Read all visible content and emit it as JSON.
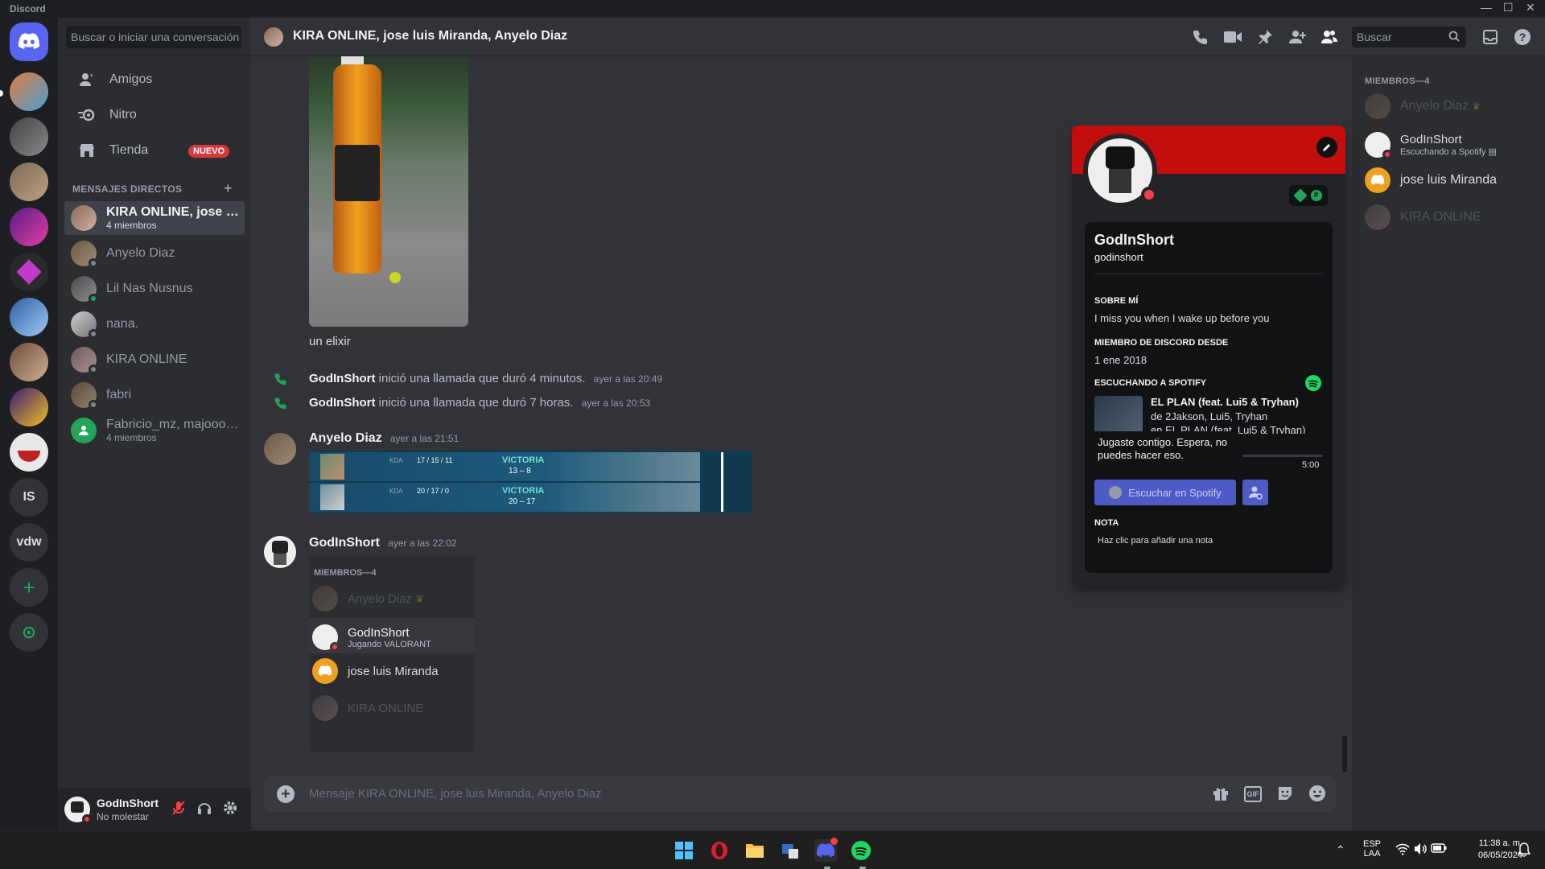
{
  "window": {
    "title": "Discord",
    "controls": [
      "—",
      "☐",
      "✕"
    ]
  },
  "servers": {
    "items": [
      "IS",
      "vdw"
    ],
    "add": "+",
    "explore": "⊙"
  },
  "dm_panel": {
    "search_placeholder": "Buscar o iniciar una conversación",
    "nav": [
      {
        "label": "Amigos",
        "icon": "friends-icon"
      },
      {
        "label": "Nitro",
        "icon": "nitro-icon"
      },
      {
        "label": "Tienda",
        "icon": "shop-icon",
        "badge": "NUEVO"
      }
    ],
    "section_label": "MENSAJES DIRECTOS",
    "section_add": "+",
    "dms": [
      {
        "name": "KIRA ONLINE, jose lui...",
        "sub": "4 miembros",
        "active": true
      },
      {
        "name": "Anyelo Diaz",
        "sub": ""
      },
      {
        "name": "Lil Nas Nusnus",
        "sub": ""
      },
      {
        "name": "nana.",
        "sub": ""
      },
      {
        "name": "KIRA ONLINE",
        "sub": ""
      },
      {
        "name": "fabri",
        "sub": ""
      },
      {
        "name": "Fabricio_mz, majooo, ...",
        "sub": "4 miembros"
      }
    ]
  },
  "user_panel": {
    "name": "GodInShort",
    "status": "No molestar"
  },
  "chat_header": {
    "title": "KIRA ONLINE, jose luis Miranda, Anyelo Diaz",
    "search_placeholder": "Buscar"
  },
  "messages": {
    "caption": "un elixir",
    "calls": [
      {
        "user": "GodInShort",
        "text": "inició una llamada que duró 4 minutos.",
        "time": "ayer a las 20:49"
      },
      {
        "user": "GodInShort",
        "text": "inició una llamada que duró 7 horas.",
        "time": "ayer a las 20:53"
      }
    ],
    "anyelo": {
      "user": "Anyelo Diaz",
      "time": "ayer a las 21:51",
      "matches": [
        {
          "kda_label": "KDA",
          "kda": "17 / 15 / 11",
          "result": "VICTORIA",
          "score": "13 – 8"
        },
        {
          "kda_label": "KDA",
          "kda": "20 / 17 / 0",
          "result": "VICTORIA",
          "score": "20 – 17"
        }
      ]
    },
    "godin": {
      "user": "GodInShort",
      "time": "ayer a las 22:02",
      "embed_header": "MIEMBROS—4",
      "embed_members": [
        {
          "name": "Anyelo Diaz",
          "sub": "",
          "dim": true
        },
        {
          "name": "GodInShort",
          "sub": "Jugando VALORANT",
          "dim": false
        },
        {
          "name": "jose luis Miranda",
          "sub": "",
          "dim": false
        },
        {
          "name": "KIRA ONLINE",
          "sub": "",
          "dim": true
        }
      ]
    }
  },
  "composer": {
    "placeholder": "Mensaje KIRA ONLINE, jose luis Miranda, Anyelo Diaz",
    "gif": "GIF"
  },
  "members_panel": {
    "header": "MIEMBROS—4",
    "items": [
      {
        "name": "Anyelo Diaz",
        "sub": "",
        "dim": true
      },
      {
        "name": "GodInShort",
        "sub": "Escuchando a Spotify",
        "dim": false
      },
      {
        "name": "jose luis Miranda",
        "sub": "",
        "dim": false
      },
      {
        "name": "KIRA ONLINE",
        "sub": "",
        "dim": true
      }
    ]
  },
  "profile": {
    "display_name": "GodInShort",
    "username": "godinshort",
    "about_label": "SOBRE MÍ",
    "about": "I miss you when I wake up before you",
    "member_since_label": "MIEMBRO DE DISCORD DESDE",
    "member_since": "1 ene 2018",
    "spotify_label": "ESCUCHANDO A SPOTIFY",
    "song": "EL PLAN (feat. Lui5 & Tryhan)",
    "artist": "de 2Jakson, Lui5, Tryhan",
    "album": "en EL PLAN (feat. Lui5 & Tryhan)",
    "tooltip": "Jugaste contigo. Espera, no puedes hacer eso.",
    "duration": "5:00",
    "listen_button": "Escuchar en Spotify",
    "note_label": "NOTA",
    "note_placeholder": "Haz clic para añadir una nota",
    "colors": {
      "banner": "#c40d0d"
    }
  },
  "taskbar": {
    "lang": "ESP",
    "layout": "LAA",
    "time": "11:38 a. m.",
    "date": "06/05/2024"
  }
}
